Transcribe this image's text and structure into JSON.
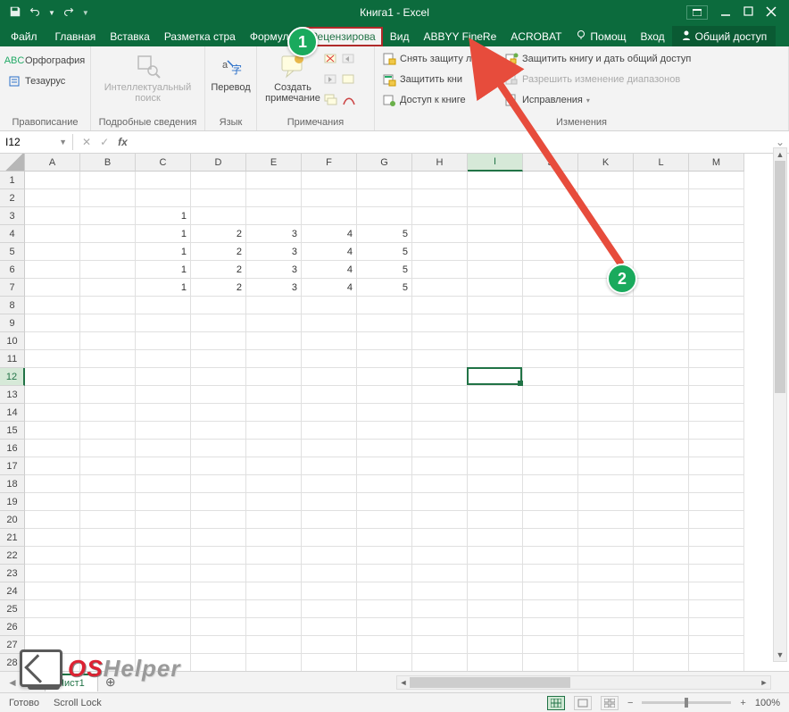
{
  "title": "Книга1 - Excel",
  "qat": {
    "save": "save-icon",
    "undo": "undo-icon",
    "redo": "redo-icon"
  },
  "tabs": {
    "file": "Файл",
    "items": [
      "Главная",
      "Вставка",
      "Разметка стра",
      "Формулы"
    ],
    "active": "Рецензирова",
    "after": [
      "Вид",
      "ABBYY FineRe",
      "ACROBAT"
    ],
    "help": "Помощ",
    "signin": "Вход",
    "share": "Общий доступ"
  },
  "ribbon": {
    "proofing": {
      "spelling": "Орфография",
      "thesaurus": "Тезаурус",
      "label": "Правописание"
    },
    "insights": {
      "smart": "Интеллектуальный поиск",
      "label": "Подробные сведения"
    },
    "language": {
      "translate": "Перевод",
      "label": "Язык"
    },
    "comments": {
      "new": "Создать примечание",
      "label": "Примечания"
    },
    "changes": {
      "unprotect": "Снять защиту листа",
      "protect_wb": "Защитить кни",
      "share_wb": "Доступ к книге",
      "protect_share": "Защитить книгу и дать общий доступ",
      "allow_ranges": "Разрешить изменение диапазонов",
      "track": "Исправления",
      "label": "Изменения"
    }
  },
  "namebox": "I12",
  "formula": "",
  "columns": [
    "A",
    "B",
    "C",
    "D",
    "E",
    "F",
    "G",
    "H",
    "I",
    "J",
    "K",
    "L",
    "M"
  ],
  "rows_visible": 28,
  "selected": {
    "col": "I",
    "row": 12
  },
  "grid_data": {
    "3": {
      "C": "1"
    },
    "4": {
      "C": "1",
      "D": "2",
      "E": "3",
      "F": "4",
      "G": "5"
    },
    "5": {
      "C": "1",
      "D": "2",
      "E": "3",
      "F": "4",
      "G": "5"
    },
    "6": {
      "C": "1",
      "D": "2",
      "E": "3",
      "F": "4",
      "G": "5"
    },
    "7": {
      "C": "1",
      "D": "2",
      "E": "3",
      "F": "4",
      "G": "5"
    }
  },
  "sheet": {
    "name": "Лист1"
  },
  "status": {
    "ready": "Готово",
    "scroll": "Scroll Lock",
    "zoom": "100%"
  },
  "annotations": {
    "badge1": "1",
    "badge2": "2"
  },
  "watermark": {
    "os": "OS",
    "helper": "Helper"
  }
}
